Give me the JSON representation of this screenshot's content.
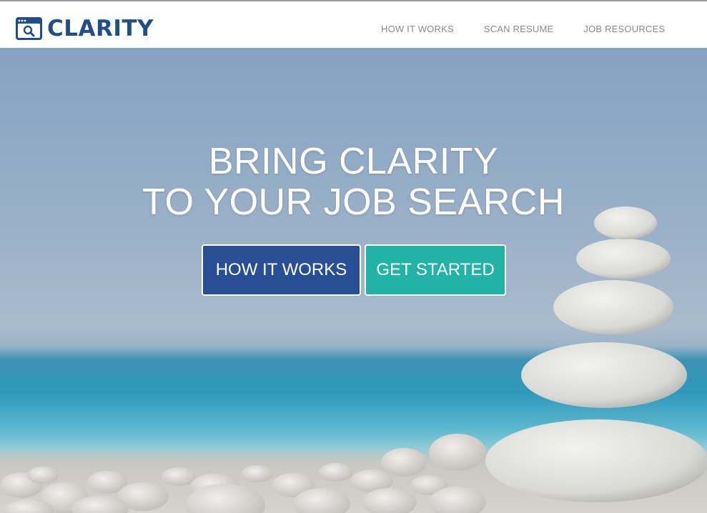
{
  "brand": {
    "name": "CLARITY",
    "logo_icon": "search-window-icon",
    "color": "#1f4f86"
  },
  "nav": {
    "links": [
      {
        "label": "HOW IT WORKS"
      },
      {
        "label": "SCAN RESUME"
      },
      {
        "label": "JOB RESOURCES"
      }
    ]
  },
  "hero": {
    "headline_line1": "BRING CLARITY",
    "headline_line2": "TO YOUR JOB SEARCH",
    "buttons": {
      "how_it_works": {
        "label": "HOW IT WORKS",
        "color": "#284f94"
      },
      "get_started": {
        "label": "GET STARTED",
        "color": "#22b3a6"
      }
    }
  }
}
